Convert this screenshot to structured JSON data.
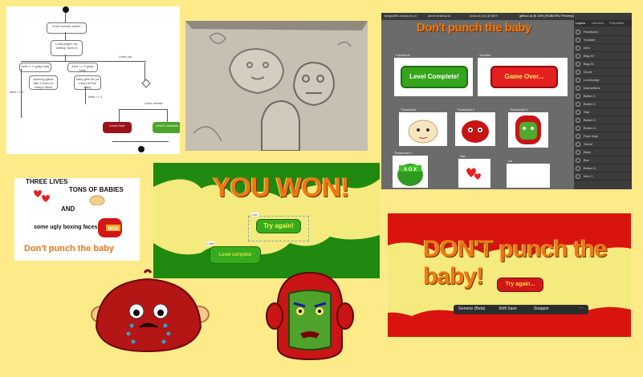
{
  "flowchart": {
    "start_label": "Start",
    "boxes": [
      "Enter screen switch",
      "Load player var setting: lives=3",
      "lives != 0 (play bad)",
      "lives == 0 (play lose)",
      "opening game with 3 lives on baby's head",
      "baby gets hit (or miss) hit the baby",
      "Level Over",
      "Level Complete"
    ],
    "labels": [
      "Lives var",
      "lives == 0",
      "lives == 3",
      "Lives remain",
      "Tap = hit",
      "Not 3 = lose"
    ]
  },
  "illustrator": {
    "tabs": [
      "fangsmith.com/p.pe.ux",
      "anne desktop.ai",
      "docs.ai (.ai) @ 66%",
      "giftbox.ai @ 33% (RGB/GPU Preview)"
    ],
    "canvas_title": "Don't punch the baby",
    "btn_complete": "Level Complete!",
    "btn_over": "Game Over...",
    "artboards": [
      "Facebook",
      "Youtube",
      "Thumbnail",
      "Thumbnail 2",
      "Thumbnail 3",
      "Thumbnail 4",
      "Nav",
      "Ad",
      "Thumbnail 5"
    ],
    "panel_tabs": [
      "Layers",
      "Libraries",
      "Properties"
    ],
    "layers": [
      "Facebook",
      "Youtube",
      "Intro",
      "Bag 20",
      "Bag 21",
      "Grunt",
      "Levelcomp",
      "Instructions",
      "Button 1",
      "Button 2",
      "Sad",
      "Button 3",
      "Button 4",
      "Face map",
      "Scene",
      "Baby",
      "Box",
      "Button 5",
      "Intro 1"
    ]
  },
  "thumbnail": {
    "line1": "THREE LIVES",
    "line2": "TONS OF BABIES",
    "line3": "AND",
    "line4": "some ugly boxing faces",
    "line5": "Don't punch the baby",
    "badge": "BOX"
  },
  "won": {
    "title": "YOU WON!",
    "btn_try": "Try again!",
    "btn_level": "Level complete",
    "tag_try": "Lbb",
    "tag_level": "Lvlst"
  },
  "lose": {
    "title": "DON'T punch the baby!",
    "btn_try": "Try again...",
    "toolbar": [
      "Generar (Beta)",
      "Shift Save",
      "Snapper"
    ]
  },
  "box_badge": "A O X",
  "colors": {
    "background": "#fdeb8a",
    "green": "#1f8a0f",
    "red": "#d9140e",
    "orange_title": "#ea7a12",
    "yellow_blob": "#f4ea7e"
  }
}
